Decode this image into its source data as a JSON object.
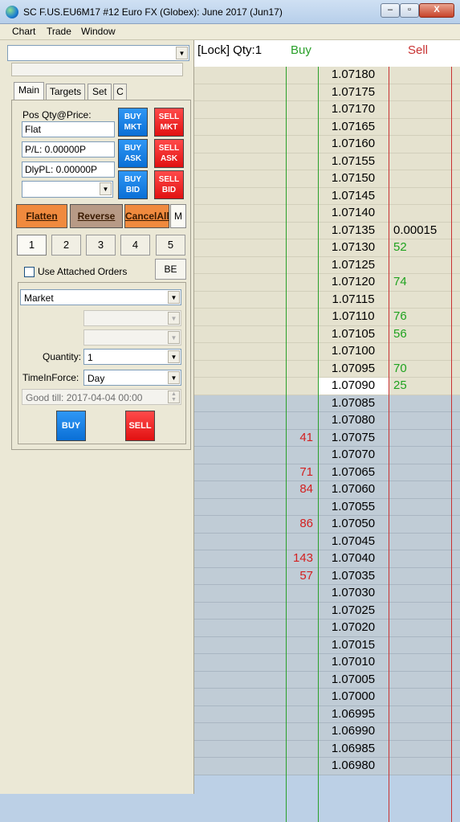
{
  "window": {
    "title": "SC F.US.EU6M17  #12  Euro FX (Globex): June 2017 (Jun17)",
    "controls": [
      "–",
      "▫",
      "X"
    ]
  },
  "menu": [
    "Chart",
    "Trade",
    "Window"
  ],
  "left": {
    "tabs": [
      "Main",
      "Targets",
      "Set",
      "C"
    ],
    "pos_label": "Pos Qty@Price:",
    "pos_value": "Flat",
    "pl_value": "P/L: 0.00000P",
    "dlypl_value": "DlyPL: 0.00000P",
    "buttons": {
      "buy_mkt": [
        "BUY",
        "MKT"
      ],
      "sell_mkt": [
        "SELL",
        "MKT"
      ],
      "buy_ask": [
        "BUY",
        "ASK"
      ],
      "sell_ask": [
        "SELL",
        "ASK"
      ],
      "buy_bid": [
        "BUY",
        "BID"
      ],
      "sell_bid": [
        "SELL",
        "BID"
      ]
    },
    "flatten": "Flatten",
    "reverse": "Reverse",
    "cancel_all": "CancelAll",
    "m_label": "M",
    "numbers": [
      "1",
      "2",
      "3",
      "4",
      "5"
    ],
    "use_attached": "Use Attached Orders",
    "be_label": "BE",
    "order_type": "Market",
    "quantity_label": "Quantity:",
    "quantity_value": "1",
    "tif_label": "TimeInForce:",
    "tif_value": "Day",
    "good_till": "Good till: 2017-04-04 00:00",
    "buy_label": "BUY",
    "sell_label": "SELL"
  },
  "dom": {
    "header_lock": "[Lock] Qty:1",
    "header_buy": "Buy",
    "header_sell": "Sell",
    "current_price": "1.07090",
    "rows": [
      {
        "price": "1.07180",
        "buy": "",
        "sell": ""
      },
      {
        "price": "1.07175",
        "buy": "",
        "sell": ""
      },
      {
        "price": "1.07170",
        "buy": "",
        "sell": ""
      },
      {
        "price": "1.07165",
        "buy": "",
        "sell": ""
      },
      {
        "price": "1.07160",
        "buy": "",
        "sell": ""
      },
      {
        "price": "1.07155",
        "buy": "",
        "sell": ""
      },
      {
        "price": "1.07150",
        "buy": "",
        "sell": ""
      },
      {
        "price": "1.07145",
        "buy": "",
        "sell": ""
      },
      {
        "price": "1.07140",
        "buy": "",
        "sell": ""
      },
      {
        "price": "1.07135",
        "buy": "",
        "sell": "0.00015"
      },
      {
        "price": "1.07130",
        "buy": "",
        "sell": "52"
      },
      {
        "price": "1.07125",
        "buy": "",
        "sell": ""
      },
      {
        "price": "1.07120",
        "buy": "",
        "sell": "74"
      },
      {
        "price": "1.07115",
        "buy": "",
        "sell": ""
      },
      {
        "price": "1.07110",
        "buy": "",
        "sell": "76"
      },
      {
        "price": "1.07105",
        "buy": "",
        "sell": "56"
      },
      {
        "price": "1.07100",
        "buy": "",
        "sell": ""
      },
      {
        "price": "1.07095",
        "buy": "",
        "sell": "70"
      },
      {
        "price": "1.07090",
        "buy": "",
        "sell": "25"
      },
      {
        "price": "1.07085",
        "buy": "",
        "sell": ""
      },
      {
        "price": "1.07080",
        "buy": "",
        "sell": ""
      },
      {
        "price": "1.07075",
        "buy": "41",
        "sell": ""
      },
      {
        "price": "1.07070",
        "buy": "",
        "sell": ""
      },
      {
        "price": "1.07065",
        "buy": "71",
        "sell": ""
      },
      {
        "price": "1.07060",
        "buy": "84",
        "sell": ""
      },
      {
        "price": "1.07055",
        "buy": "",
        "sell": ""
      },
      {
        "price": "1.07050",
        "buy": "86",
        "sell": ""
      },
      {
        "price": "1.07045",
        "buy": "",
        "sell": ""
      },
      {
        "price": "1.07040",
        "buy": "143",
        "sell": ""
      },
      {
        "price": "1.07035",
        "buy": "57",
        "sell": ""
      },
      {
        "price": "1.07030",
        "buy": "",
        "sell": ""
      },
      {
        "price": "1.07025",
        "buy": "",
        "sell": ""
      },
      {
        "price": "1.07020",
        "buy": "",
        "sell": ""
      },
      {
        "price": "1.07015",
        "buy": "",
        "sell": ""
      },
      {
        "price": "1.07010",
        "buy": "",
        "sell": ""
      },
      {
        "price": "1.07005",
        "buy": "",
        "sell": ""
      },
      {
        "price": "1.07000",
        "buy": "",
        "sell": ""
      },
      {
        "price": "1.06995",
        "buy": "",
        "sell": ""
      },
      {
        "price": "1.06990",
        "buy": "",
        "sell": ""
      },
      {
        "price": "1.06985",
        "buy": "",
        "sell": ""
      },
      {
        "price": "1.06980",
        "buy": "",
        "sell": ""
      }
    ],
    "colors": {
      "ask_bg": "#e5e2cf",
      "bid_bg": "#c0ccd6",
      "current_bg": "#ffffff",
      "buy_line": "#2aa02a",
      "sell_line": "#c83232",
      "sell_text": "#1fa31f",
      "buy_text": "#d32020"
    }
  }
}
